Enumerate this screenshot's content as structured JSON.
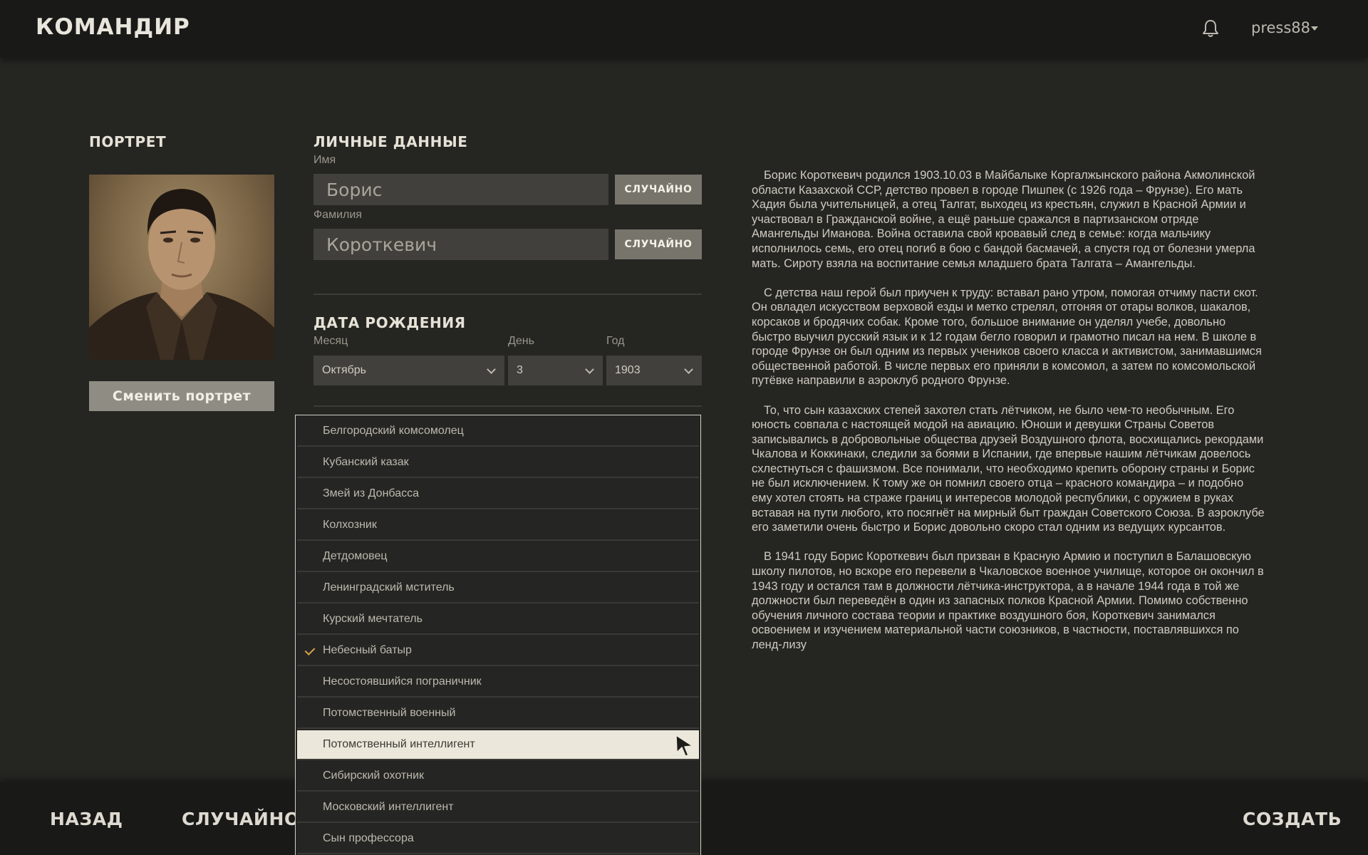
{
  "app": {
    "title": "КОМАНДИР",
    "username": "press88"
  },
  "portrait_section": {
    "title": "ПОРТРЕТ",
    "change_button": "Сменить портрет"
  },
  "personal": {
    "title": "ЛИЧНЫЕ ДАННЫЕ",
    "first_name_label": "Имя",
    "first_name_value": "Борис",
    "last_name_label": "Фамилия",
    "last_name_value": "Короткевич",
    "random_label": "СЛУЧАЙНО"
  },
  "birth": {
    "title": "ДАТА РОЖДЕНИЯ",
    "month_label": "Месяц",
    "month_value": "Октябрь",
    "day_label": "День",
    "day_value": "3",
    "year_label": "Год",
    "year_value": "1903"
  },
  "background_options": [
    "Белгородский комсомолец",
    "Кубанский казак",
    "Змей из Донбасса",
    "Колхозник",
    "Детдомовец",
    "Ленинградский мститель",
    "Курский мечтатель",
    "Небесный батыр",
    "Несостоявшийся пограничник",
    "Потомственный военный",
    "Потомственный интеллигент",
    "Сибирский охотник",
    "Московский интеллигент",
    "Сын профессора"
  ],
  "background_selected": "Небесный батыр",
  "background_hovered": "Потомственный интеллигент",
  "accent_check_color": "#d8a44c",
  "bio": [
    "Борис Короткевич родился 1903.10.03 в Майбалыке Коргалжынского района Акмолинской области Казахской ССР, детство провел в городе Пишпек (с 1926 года – Фрунзе). Его мать Хадия была учительницей, а отец Талгат, выходец из крестьян, служил в Красной Армии и участвовал в Гражданской войне, а ещё раньше сражался в партизанском отряде Амангельды Иманова. Война оставила свой кровавый след в семье: когда мальчику исполнилось семь, его отец погиб в бою с бандой басмачей, а спустя год от болезни умерла мать. Сироту взяла на воспитание семья младшего брата Талгата – Амангельды.",
    "С детства наш герой был приучен к труду: вставал рано утром, помогая отчиму пасти скот. Он овладел искусством верховой езды и метко стрелял, отгоняя от отары волков, шакалов, корсаков и бродячих собак. Кроме того, большое внимание он уделял учебе, довольно быстро выучил русский язык и к 12 годам бегло говорил и грамотно писал на нем. В школе в городе Фрунзе он был одним из первых учеников своего класса и активистом, занимавшимся общественной работой. В числе первых его приняли в комсомол, а затем по комсомольской путёвке направили в аэроклуб родного Фрунзе.",
    "То, что сын казахских степей захотел стать лётчиком, не было чем-то необычным. Его юность совпала с настоящей модой на авиацию. Юноши и девушки Страны Советов записывались в добровольные общества друзей Воздушного флота, восхищались рекордами Чкалова и Коккинаки, следили за боями в Испании, где впервые нашим лётчикам довелось схлестнуться с фашизмом. Все понимали, что необходимо крепить оборону страны и Борис не был исключением. К тому же он помнил своего отца – красного командира – и подобно ему хотел стоять на страже границ и интересов молодой республики, с оружием в руках вставая на пути любого, кто посягнёт на мирный быт граждан Советского Союза. В аэроклубе его заметили очень быстро и Борис довольно скоро стал одним из ведущих курсантов.",
    "В 1941 году Борис Короткевич был призван в Красную Армию и поступил в Балашовскую школу пилотов, но вскоре его перевели в Чкаловское военное училище, которое он окончил в 1943 году и остался там в должности лётчика-инструктора, а в начале 1944 года в той же должности был переведён в один из запасных полков Красной Армии. Помимо собственно обучения личного состава теории и практике воздушного боя, Короткевич занимался освоением и изучением материальной части союзников, в частности, поставлявшихся по ленд-лизу"
  ],
  "bottom": {
    "back": "НАЗАД",
    "random": "СЛУЧАЙНО",
    "create": "СОЗДАТЬ"
  }
}
